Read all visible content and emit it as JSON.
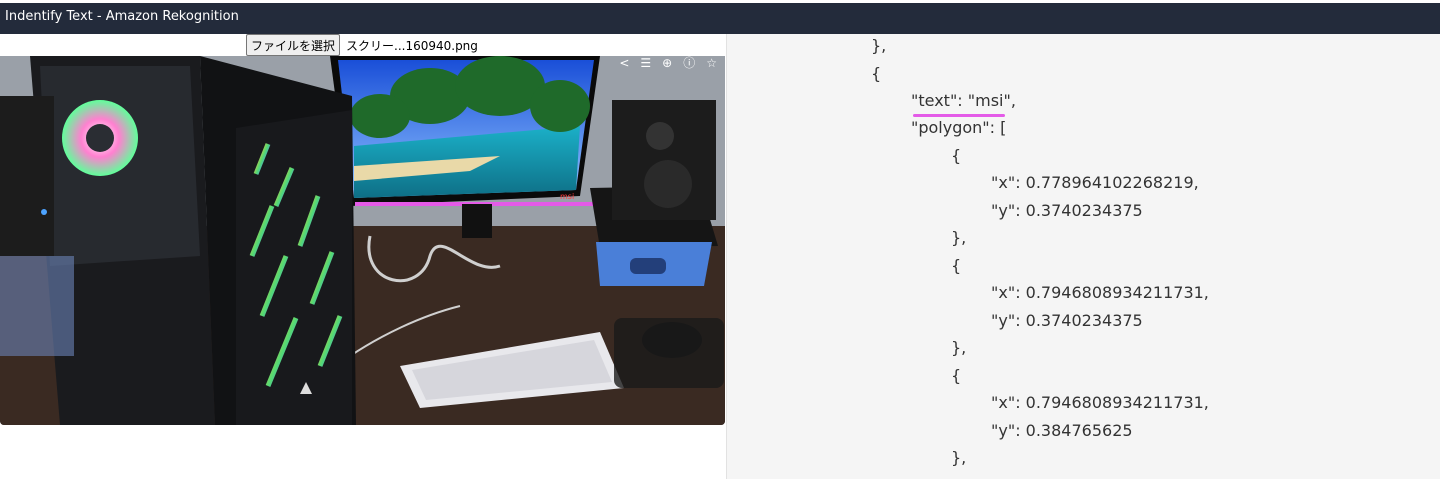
{
  "window": {
    "title": "Indentify Text - Amazon Rekognition"
  },
  "file_input": {
    "button_label": "ファイルを選択",
    "file_name": "スクリー...160940.png"
  },
  "image": {
    "toolbar_icons": [
      "share-icon",
      "adjust-icon",
      "zoom-icon",
      "info-icon",
      "star-icon"
    ],
    "toolbar_glyphs": [
      "<",
      "☰",
      "⊕",
      "ⓘ",
      "☆"
    ],
    "monitor_logo_text": "msi",
    "accent_color": "#e45be8"
  },
  "json_view": {
    "lines": [
      "},",
      "{",
      "\"text\": \"msi\",",
      "\"polygon\": [",
      "{",
      "\"x\": 0.778964102268219,",
      "\"y\": 0.3740234375",
      "},",
      "{",
      "\"x\": 0.7946808934211731,",
      "\"y\": 0.3740234375",
      "},",
      "{",
      "\"x\": 0.7946808934211731,",
      "\"y\": 0.384765625",
      "},"
    ]
  }
}
